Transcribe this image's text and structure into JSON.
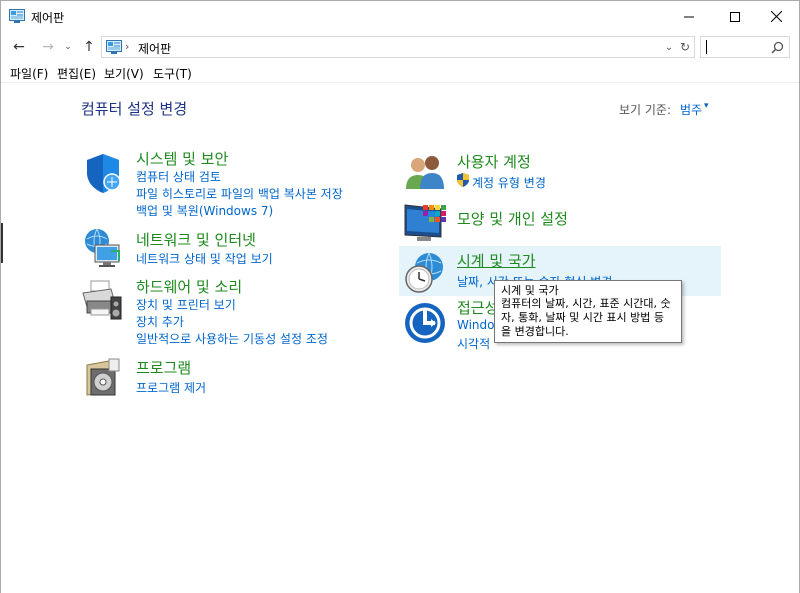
{
  "window": {
    "title": "제어판",
    "minimize_glyph": "—",
    "maximize_glyph": "☐",
    "close_glyph": "✕"
  },
  "nav": {
    "back_glyph": "←",
    "forward_glyph": "→",
    "history_glyph": "⌄",
    "up_glyph": "↑"
  },
  "address": {
    "separator": "›",
    "path": "제어판",
    "dropdown_glyph": "⌄",
    "refresh_glyph": "↻"
  },
  "menu": {
    "file": "파일(F)",
    "edit": "편집(E)",
    "view": "보기(V)",
    "tools": "도구(T)"
  },
  "header": {
    "title": "컴퓨터 설정 변경",
    "viewby_label": "보기 기준:",
    "viewby_value": "범주",
    "viewby_arrow": "▾"
  },
  "categories": {
    "security": {
      "title": "시스템 및 보안",
      "links": [
        "컴퓨터 상태 검토",
        "파일 히스토리로 파일의 백업 복사본 저장",
        "백업 및 복원(Windows 7)"
      ]
    },
    "network": {
      "title": "네트워크 및 인터넷",
      "links": [
        "네트워크 상태 및 작업 보기"
      ]
    },
    "hardware": {
      "title": "하드웨어 및 소리",
      "links": [
        "장치 및 프린터 보기",
        "장치 추가",
        "일반적으로 사용하는 기동성 설정 조정"
      ]
    },
    "programs": {
      "title": "프로그램",
      "links": [
        "프로그램 제거"
      ]
    },
    "accounts": {
      "title": "사용자 계정",
      "links": [
        "계정 유형 변경"
      ]
    },
    "appearance": {
      "title": "모양 및 개인 설정",
      "links": []
    },
    "clock": {
      "title": "시계 및 국가",
      "links": [
        "날짜, 시간 또는 숫자 형식 변경"
      ]
    },
    "ease": {
      "title": "접근성",
      "links": [
        "Windows",
        "시각적"
      ]
    }
  },
  "tooltip": {
    "title": "시계 및 국가",
    "lines": [
      "컴퓨터의 날짜, 시간, 표준 시간대, 숫",
      "자, 통화, 날짜 및 시간 표시 방법 등",
      "을 변경합니다."
    ]
  },
  "colors": {
    "category_title": "#1e8a1e",
    "link": "#0066cc",
    "page_title": "#1e3287",
    "hover": "#e5f3fb"
  }
}
